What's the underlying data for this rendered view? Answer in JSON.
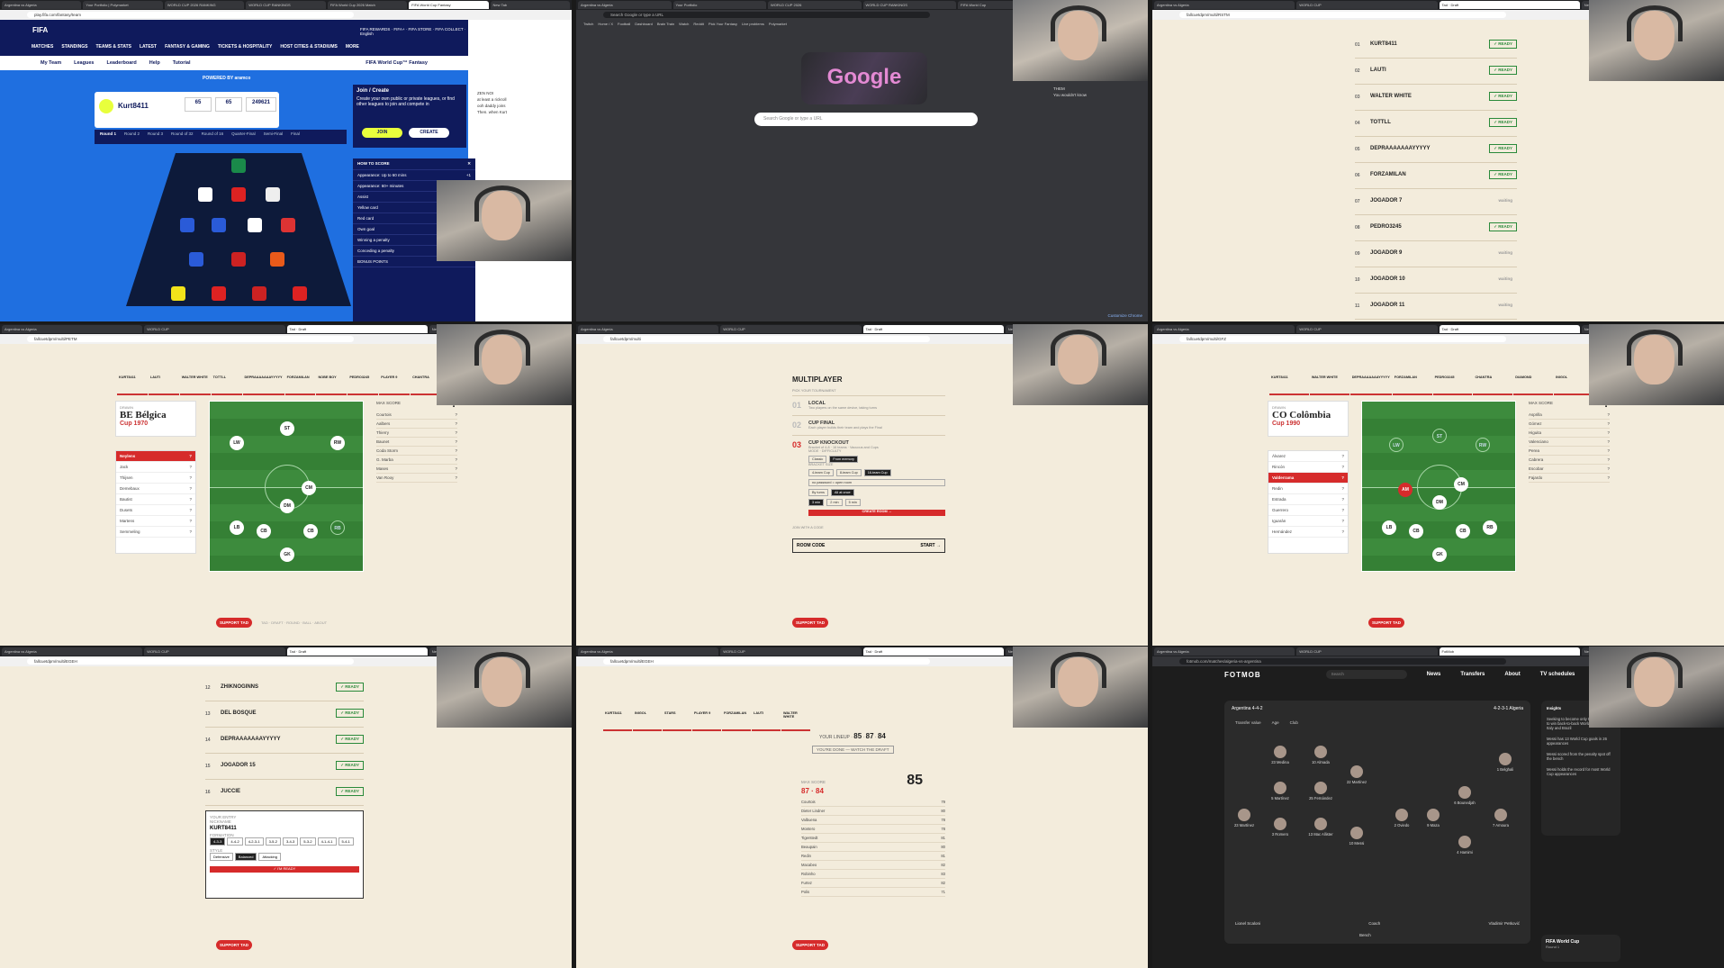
{
  "panels": {
    "fifa": {
      "url": "play.fifa.com/fantasy/team",
      "logo": "FIFA",
      "top_links": "FIFA REWARDS · FIFA+ · FIFA STORE · FIFA COLLECT · English",
      "menu": [
        "MATCHES",
        "STANDINGS",
        "TEAMS & STATS",
        "LATEST",
        "FANTASY & GAMING",
        "TICKETS & HOSPITALITY",
        "HOST CITIES & STADIUMS",
        "MORE"
      ],
      "subnav": [
        "My Team",
        "Leagues",
        "Leaderboard",
        "Help",
        "Tutorial"
      ],
      "subnav_right": "FIFA World Cup™ Fantasy",
      "powered": "POWERED BY aramco",
      "team_name": "Kurt8411",
      "stats": [
        {
          "v": "65",
          "l": "Total pts"
        },
        {
          "v": "65",
          "l": "RD pts"
        },
        {
          "v": "249621",
          "l": "Rank"
        }
      ],
      "rounds": [
        "Round 1",
        "Round 2",
        "Round 3",
        "Round of 32",
        "Round of 16",
        "Quarter-Final",
        "Semi-Final",
        "Final"
      ],
      "join_title": "Join / Create",
      "join_text": "Create your own public or private leagues, or find other leagues to join and compete in",
      "join_btn": "JOIN",
      "create_btn": "CREATE",
      "score_title": "HOW TO SCORE",
      "score_rows": [
        {
          "k": "Appearance: Up to 60 mins",
          "v": "+1"
        },
        {
          "k": "Appearance: 60+ minutes",
          "v": "+2"
        },
        {
          "k": "Assist",
          "v": "+3"
        },
        {
          "k": "Yellow card",
          "v": "-1"
        },
        {
          "k": "Red card",
          "v": "-3"
        },
        {
          "k": "Own goal",
          "v": "-2"
        },
        {
          "k": "Winning a penalty",
          "v": "+2"
        },
        {
          "k": "Conceding a penalty",
          "v": "-1"
        },
        {
          "k": "BONUS POINTS",
          "v": ""
        }
      ]
    },
    "google": {
      "url": "Search Google or type a URL",
      "logo": "Google",
      "search_placeholder": "Search Google or type a URL",
      "customize": "Customize Chrome",
      "bookmarks": [
        "Twitch",
        "Home / X",
        "Football",
        "Dashboard",
        "Brain Train",
        "Watch",
        "Reddit",
        "Pick Your Fantasy",
        "Live problems",
        "Polymarket",
        "Google Sheets"
      ]
    },
    "draft_list": {
      "url": "fallcuetdpm/multi/RSTM",
      "rows": [
        {
          "n": "01",
          "name": "KURT8411",
          "tag": "✓ READY"
        },
        {
          "n": "02",
          "name": "LAUTI",
          "tag": "✓ READY"
        },
        {
          "n": "03",
          "name": "WALTER WHITE",
          "tag": "✓ READY"
        },
        {
          "n": "04",
          "name": "TOTTLL",
          "tag": "✓ READY"
        },
        {
          "n": "05",
          "name": "DEPRAAAAAAAYYYYY",
          "tag": "✓ READY"
        },
        {
          "n": "06",
          "name": "FORZAMILAN",
          "tag": "✓ READY"
        },
        {
          "n": "07",
          "name": "JOGADOR 7",
          "tag": "waiting"
        },
        {
          "n": "08",
          "name": "PEDRO3245",
          "tag": "✓ READY"
        },
        {
          "n": "09",
          "name": "JOGADOR 9",
          "tag": "waiting"
        },
        {
          "n": "10",
          "name": "JOGADOR 10",
          "tag": "waiting"
        },
        {
          "n": "11",
          "name": "JOGADOR 11",
          "tag": "waiting"
        }
      ]
    },
    "belgica": {
      "url": "fallcuetdpm/multi/PETM",
      "tabs": [
        "KURT8411",
        "LAUTI",
        "WALTER WHITE",
        "TOTTLL",
        "DEPRAAAAAAAYYYYY",
        "FORZAMILAN",
        "NOBE BOY",
        "PEDRO3245",
        "PLAYER 9",
        "CHANTRA",
        "DIAMOND",
        "INIGOL",
        "STARS",
        "ROSSO"
      ],
      "draw_label": "DRAWN",
      "country": "BE Bélgica",
      "cup": "Cup 1970",
      "pick_label": "PICK A PLAYER",
      "picks": [
        "Neylens",
        "Jack",
        "Thijsen",
        "Demebaux",
        "Bautist",
        "Dusets",
        "Martens",
        "Semmeling"
      ],
      "max_label": "MAX SCORE",
      "q": "?",
      "score_rows": [
        "Courtois",
        "Aalbers",
        "Thierry",
        "Baunet",
        "Coda Storm",
        "G. Marba",
        "Mases",
        "Van Rooy",
        "Hagi"
      ],
      "support": "SUPPORT TAD",
      "footer": "TAD · DRAFT · ROUND · BALL · ABOUT"
    },
    "multiplayer": {
      "url": "fallcuetdpm/multi",
      "title": "MULTIPLAYER",
      "sub": "PICK YOUR TOURNAMENT",
      "options": [
        {
          "n": "01",
          "t": "LOCAL",
          "d": "Two players on the same device, taking turns"
        },
        {
          "n": "02",
          "t": "CUP FINAL",
          "d": "Each player builds their team and plays the Final"
        },
        {
          "n": "03",
          "t": "CUP KNOCKOUT",
          "d": "Bracket of 4-8 · 16 teams · Vacuous and Cups"
        }
      ],
      "mode_label": "MODE · DIFFICULTY",
      "modes": [
        "Classic",
        "From memory"
      ],
      "bracket_label": "BRACKET SIZE",
      "brackets": [
        "4-team Cup",
        "8-team Cup",
        "16-team Cup"
      ],
      "password": "no password = open room",
      "draft_mode": [
        "By turns",
        "All at once"
      ],
      "timers": [
        "3 min",
        "2 min",
        "5 min"
      ],
      "create": "CREATE ROOM →",
      "join_label": "JOIN WITH A CODE",
      "room_code": "ROOM CODE",
      "start": "START →",
      "support": "SUPPORT TAD"
    },
    "colombia": {
      "url": "fallcuetdpm/multi/GFZ",
      "country": "CO Colômbia",
      "cup": "Cup 1990",
      "picks": [
        "Álvarez",
        "Rincón",
        "Valderrama",
        "Redin",
        "Estrada",
        "Guerrero",
        "Iguarán",
        "Hernández"
      ],
      "score_rows": [
        "Asprilla",
        "Gómez",
        "Higuita",
        "Valenciano",
        "Perea",
        "Cabrera",
        "Escobar",
        "Fajardo"
      ],
      "support": "SUPPORT TAD"
    },
    "entry": {
      "url": "fallcuetdpm/multi/EGEH",
      "rows": [
        {
          "n": "12",
          "name": "ZHIKNOGINNS",
          "tag": "✓ READY"
        },
        {
          "n": "13",
          "name": "DEL BOSQUE",
          "tag": "✓ READY"
        },
        {
          "n": "14",
          "name": "DEPRAAAAAAAYYYYY",
          "tag": "✓ READY"
        },
        {
          "n": "15",
          "name": "JOGADOR 15",
          "tag": "✓ READY"
        },
        {
          "n": "16",
          "name": "JUCCIE",
          "tag": "✓ READY"
        }
      ],
      "your_entry": "YOUR ENTRY",
      "nickname_label": "NICKNAME",
      "nickname": "KURT8411",
      "formation_label": "FORMATION",
      "formations": [
        "4-3-3",
        "4-4-2",
        "4-2-3-1",
        "3-5-2",
        "3-4-3",
        "5-3-2",
        "4-1-4-1",
        "5-4-1"
      ],
      "style_label": "STYLE",
      "styles": [
        "Defensive",
        "Balanced",
        "Attacking"
      ],
      "ready": "✓ I'M READY",
      "support": "SUPPORT TAD"
    },
    "score": {
      "url": "fallcuetdpm/multi/EGEH",
      "lineup_label": "YOUR LINEUP",
      "lineup_vals": [
        "85",
        "87",
        "84"
      ],
      "waiting": "YOU'RE DONE — WATCH THE DRAFT",
      "max_label": "MAX SCORE",
      "max_score": "85",
      "attack": "87",
      "defense": "84",
      "rows": [
        {
          "p": "Courtois",
          "v": "79"
        },
        {
          "p": "Dieter Lindner",
          "v": "80"
        },
        {
          "p": "Valbuena",
          "v": "78"
        },
        {
          "p": "Montero",
          "v": "78"
        },
        {
          "p": "Tigerstedt",
          "v": "81"
        },
        {
          "p": "Beaupain",
          "v": "80"
        },
        {
          "p": "Redin",
          "v": "81"
        },
        {
          "p": "Macabeo",
          "v": "82"
        },
        {
          "p": "Robinho",
          "v": "83"
        },
        {
          "p": "Furtez",
          "v": "82"
        },
        {
          "p": "Polis",
          "v": "71"
        }
      ],
      "support": "SUPPORT TAD"
    },
    "fotmob": {
      "url": "fotmob.com/matches/algeria-vs-argentina",
      "logo": "FOTMOB",
      "search": "Search",
      "nav": [
        "News",
        "Transfers",
        "About",
        "TV schedules"
      ],
      "team_left": "Argentina",
      "formation_left": "4-4-2",
      "team_right": "Algeria",
      "formation_right": "4-2-3-1",
      "tabs": [
        "Transfer value",
        "Age",
        "Club"
      ],
      "players": [
        "23 Medina",
        "10 Almada",
        "5 Martínez",
        "25 Fernández",
        "22 Martínez",
        "23 Martínez",
        "3 Romero",
        "13 Mac Allister",
        "10 Messi",
        "2 Oviedo",
        "9 Maza",
        "4 Hamimi",
        "7 Amoura",
        "1 Belghali",
        "6 Bounedjah"
      ],
      "coach_left": "Lionel Scaloni",
      "coach_label": "Coach",
      "coach_right": "Vladimir Petković",
      "bench": "Bench",
      "insights_title": "Insights",
      "insights": [
        "Seeking to become only the third nation to win back-to-back World Cups after Italy and Brazil",
        "Messi has 13 World Cup goals in 26 appearances",
        "Messi scored from the penalty spot off the bench",
        "Messi holds the record for most World Cup appearances",
        "Scored 2+ goals in World Cup qualifying",
        "Could ascend in each of his last four appearances"
      ],
      "wc_title": "FIFA World Cup",
      "wc_sub": "Round 1"
    }
  },
  "chat_lines": [
    "ZEN NOI",
    "at least a rickroll",
    "ooh daddy joins",
    "Then. when Kurt",
    "THEM",
    "You wouldn't know"
  ],
  "colors": {
    "fifa_blue": "#1f6fe0",
    "fifa_navy": "#0f1a5c",
    "tad_red": "#d62b2b",
    "cream": "#f3ecdc",
    "pitch": "#3d8b3d"
  }
}
